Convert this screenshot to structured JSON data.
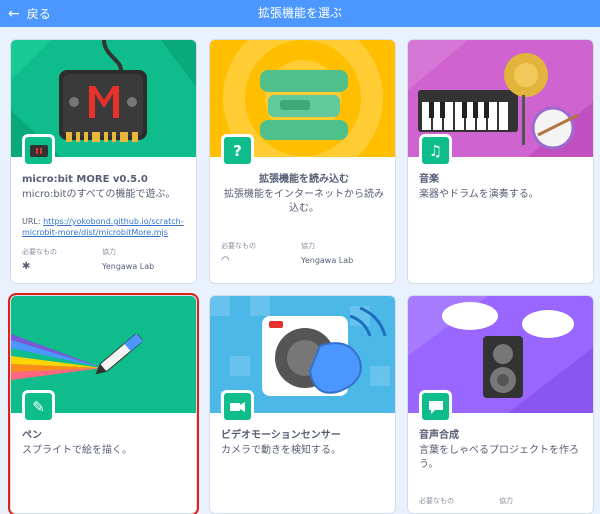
{
  "header": {
    "back_label": "戻る",
    "title": "拡張機能を選ぶ"
  },
  "labels": {
    "requires": "必要なもの",
    "collaborator": "協力"
  },
  "cards": [
    {
      "name": "micro:bit MORE v0.5.0",
      "description": "micro:bitのすべての機能で遊ぶ。",
      "url_prefix": "URL: ",
      "url": "https://yokobond.github.io/scratch-microbit-more/dist/microbitMore.mjs",
      "collaborator": "Yengawa Lab",
      "requires_icon": "bluetooth-icon",
      "badge_icon": "microbit-icon",
      "color": "#0fbd8c"
    },
    {
      "name": "拡張機能を読み込む",
      "description": "拡張機能をインターネットから読み込む。",
      "badge_text": "?",
      "collaborator": "Yengawa Lab",
      "requires_icon": "wifi-icon",
      "badge_icon": "question-icon",
      "color": "#0fbd8c"
    },
    {
      "name": "音楽",
      "description": "楽器やドラムを演奏する。",
      "badge_icon": "music-note-icon",
      "color": "#0fbd8c"
    },
    {
      "name": "ペン",
      "description": "スプライトで絵を描く。",
      "badge_icon": "pen-icon",
      "color": "#0fbd8c"
    },
    {
      "name": "ビデオモーションセンサー",
      "description": "カメラで動きを検知する。",
      "badge_icon": "video-sensing-icon",
      "color": "#0fbd8c"
    },
    {
      "name": "音声合成",
      "description": "言葉をしゃべるプロジェクトを作ろう。",
      "badge_icon": "speech-bubble-icon",
      "color": "#0fbd8c"
    }
  ],
  "colors": {
    "header": "#4c97ff",
    "background": "#e9f1fc",
    "selected_outline": "#e0201b",
    "accent": "#0fbd8c"
  }
}
